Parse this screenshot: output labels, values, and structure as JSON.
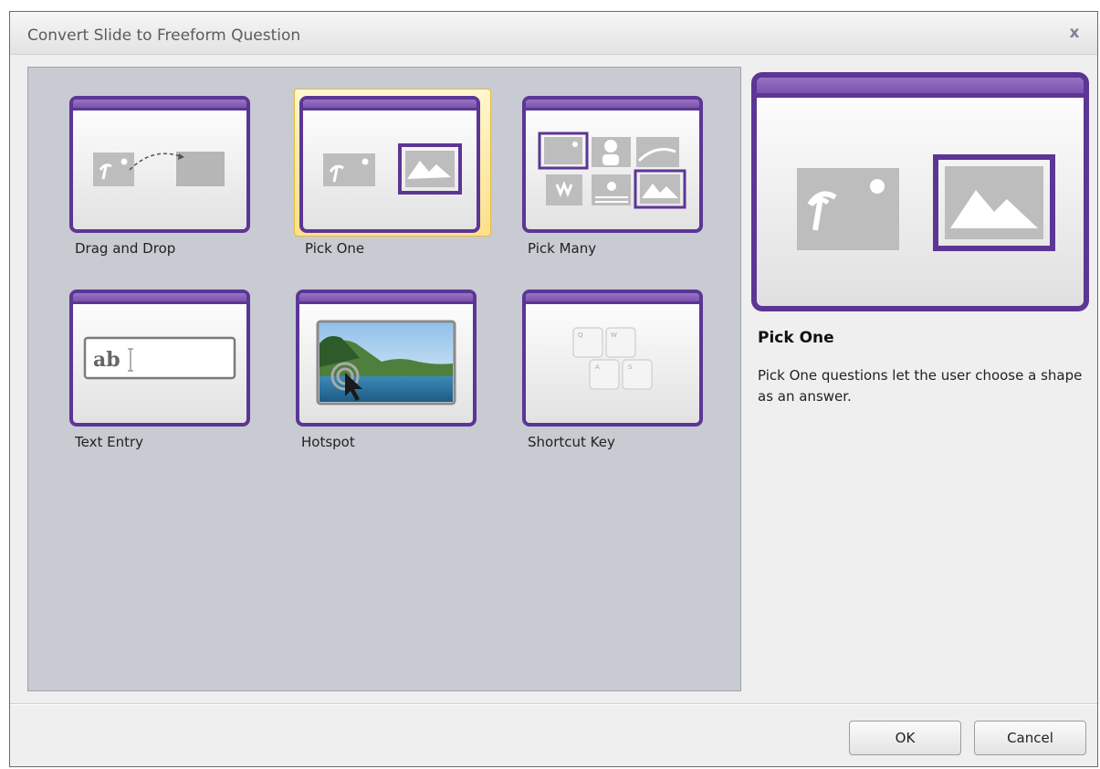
{
  "dialog": {
    "title": "Convert Slide to Freeform Question",
    "close_label": "x"
  },
  "gallery": {
    "items": [
      {
        "label": "Drag and Drop",
        "selected": false
      },
      {
        "label": "Pick One",
        "selected": true
      },
      {
        "label": "Pick Many",
        "selected": false
      },
      {
        "label": "Text Entry",
        "selected": false
      },
      {
        "label": "Hotspot",
        "selected": false
      },
      {
        "label": "Shortcut Key",
        "selected": false
      }
    ],
    "text_entry_sample": "ab",
    "shortcut_keys": [
      "Q",
      "W",
      "A",
      "S"
    ]
  },
  "preview": {
    "title": "Pick One",
    "description": "Pick One questions let the user choose a shape as an answer."
  },
  "buttons": {
    "ok": "OK",
    "cancel": "Cancel"
  },
  "colors": {
    "accent_purple": "#5c3695",
    "selection_gold": "#fde08a",
    "gallery_bg": "#c8cbd1"
  }
}
